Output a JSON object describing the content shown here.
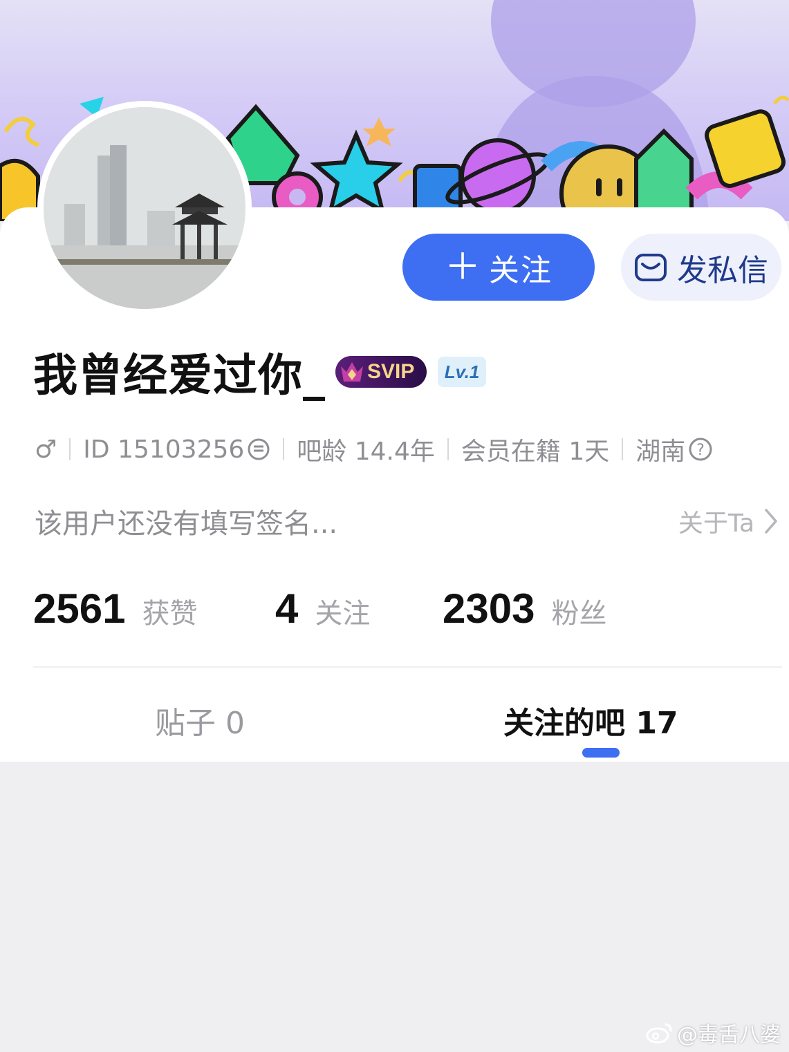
{
  "profile": {
    "username": "我曾经爱过你_",
    "svip_badge": "SVIP",
    "level_badge": "Lv.1",
    "signature": "该用户还没有填写签名...",
    "about_link": "关于Ta"
  },
  "actions": {
    "follow_label": "关注",
    "message_label": "发私信"
  },
  "meta": {
    "gender_symbol": "♂",
    "id_text": "ID 15103256",
    "bar_age": "吧龄 14.4年",
    "member_days": "会员在籍 1天",
    "location": "湖南"
  },
  "stats": [
    {
      "value": "2561",
      "label": "获赞"
    },
    {
      "value": "4",
      "label": "关注"
    },
    {
      "value": "2303",
      "label": "粉丝"
    }
  ],
  "tabs": [
    {
      "label": "贴子 0",
      "active": false
    },
    {
      "label": "关注的吧 17",
      "active": true
    }
  ],
  "watermark": "@毒舌八婆",
  "colors": {
    "accent": "#3e6ef2",
    "banner_top": "#e4e1f6",
    "banner_bottom": "#c5b8f3",
    "page_background": "#efeff1"
  },
  "icons": [
    "plus-icon",
    "mail-icon",
    "crown-icon",
    "copy-icon",
    "question-icon",
    "chevron-right-icon",
    "weibo-icon"
  ]
}
